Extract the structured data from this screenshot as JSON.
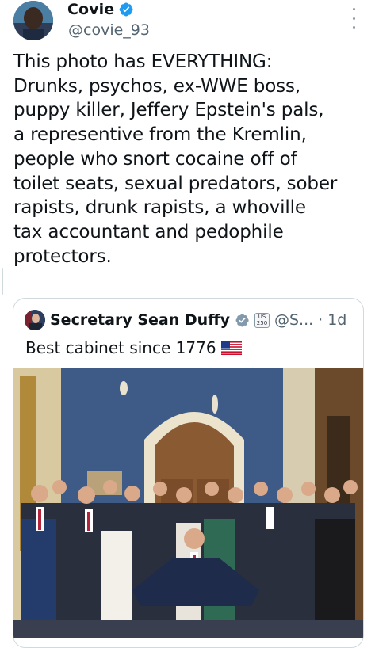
{
  "tweet": {
    "display_name": "Covie",
    "handle": "@covie_93",
    "verified": true,
    "text": "This photo has EVERYTHING:\nDrunks, psychos, ex-WWE boss,\npuppy killer, Jeffery Epstein's pals,\na representive from the Kremlin,\npeople who snort cocaine off of\ntoilet seats, sexual predators, sober\nrapists, drunk rapists, a whoville\ntax accountant and pedophile\nprotectors."
  },
  "quoted": {
    "display_name": "Secretary Sean Duffy",
    "badge_text_top": "US",
    "badge_text_bottom": "250",
    "handle": "@S...",
    "separator": "·",
    "time": "1d",
    "text": "Best cabinet since 1776",
    "flag_icon": "us-flag-icon",
    "photo_icon": "group-photo-image"
  },
  "colors": {
    "verified_blue": "#1d9bf0",
    "text_primary": "#0f1419",
    "text_secondary": "#536471",
    "border": "#cfd9de",
    "gov_badge_gray": "#829aab"
  }
}
